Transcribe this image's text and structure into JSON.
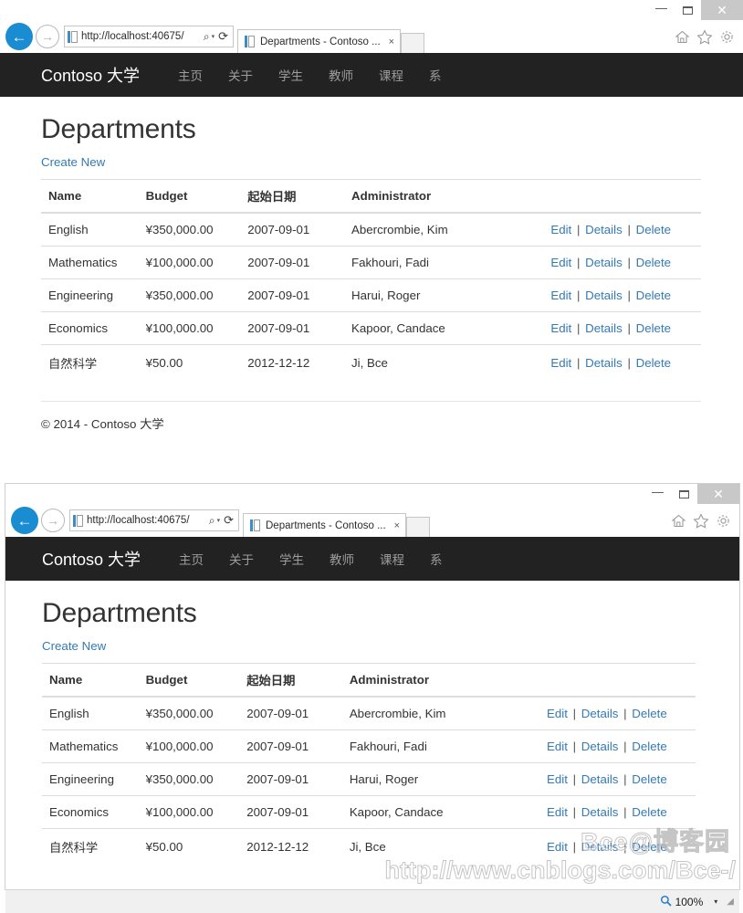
{
  "browser": {
    "address_url": "http://localhost:40675/",
    "tab_title": "Departments - Contoso ...",
    "tab_close_label": "×",
    "back_icon": "←",
    "forward_icon": "→",
    "search_icon": "⌕",
    "dropdown_icon": "▾",
    "refresh_icon": "⟳",
    "minimize_label": "—",
    "maximize_label": "",
    "close_label": "✕",
    "home_icon": "home-icon",
    "favorites_icon": "star-icon",
    "settings_icon": "gear-icon"
  },
  "site": {
    "brand": "Contoso 大学",
    "nav": [
      {
        "label": "主页"
      },
      {
        "label": "关于"
      },
      {
        "label": "学生"
      },
      {
        "label": "教师"
      },
      {
        "label": "课程"
      },
      {
        "label": "系"
      }
    ]
  },
  "main": {
    "title": "Departments",
    "create_new": "Create New",
    "columns": [
      "Name",
      "Budget",
      "起始日期",
      "Administrator",
      ""
    ],
    "rows": [
      {
        "name": "English",
        "budget": "¥350,000.00",
        "date": "2007-09-01",
        "administrator": "Abercrombie, Kim",
        "actions": [
          "Edit",
          "Details",
          "Delete"
        ]
      },
      {
        "name": "Mathematics",
        "budget": "¥100,000.00",
        "date": "2007-09-01",
        "administrator": "Fakhouri, Fadi",
        "actions": [
          "Edit",
          "Details",
          "Delete"
        ]
      },
      {
        "name": "Engineering",
        "budget": "¥350,000.00",
        "date": "2007-09-01",
        "administrator": "Harui, Roger",
        "actions": [
          "Edit",
          "Details",
          "Delete"
        ]
      },
      {
        "name": "Economics",
        "budget": "¥100,000.00",
        "date": "2007-09-01",
        "administrator": "Kapoor, Candace",
        "actions": [
          "Edit",
          "Details",
          "Delete"
        ]
      },
      {
        "name": "自然科学",
        "budget": "¥50.00",
        "date": "2012-12-12",
        "administrator": "Ji, Bce",
        "actions": [
          "Edit",
          "Details",
          "Delete"
        ]
      }
    ],
    "action_separator": "|",
    "footer": "© 2014 - Contoso 大学"
  },
  "statusbar": {
    "zoom_level": "100%",
    "zoom_icon": "magnifier-icon",
    "caret_icon": "▾"
  },
  "watermark": {
    "brand": "Bce@博客园",
    "url": "http://www.cnblogs.com/Bce-/"
  },
  "colors": {
    "navbar_bg": "#222222",
    "link": "#337ab7",
    "back_button": "#1a8cd2",
    "text": "#333333",
    "nav_link": "#9d9d9d"
  }
}
